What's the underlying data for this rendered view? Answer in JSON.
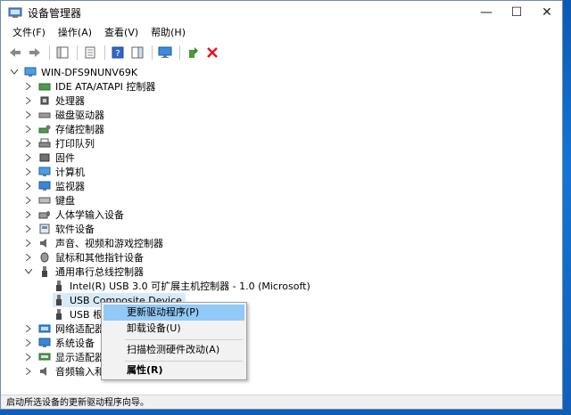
{
  "window": {
    "title": "设备管理器"
  },
  "controls": {
    "minimize": "—",
    "maximize": "☐",
    "close": "✕"
  },
  "menubar": [
    "文件(F)",
    "操作(A)",
    "查看(V)",
    "帮助(H)"
  ],
  "tree": {
    "root": "WIN-DFS9NUNV69K",
    "categories": [
      "IDE ATA/ATAPI 控制器",
      "处理器",
      "磁盘驱动器",
      "存储控制器",
      "打印队列",
      "固件",
      "计算机",
      "监视器",
      "键盘",
      "人体学输入设备",
      "软件设备",
      "声音、视频和游戏控制器",
      "鼠标和其他指针设备",
      "通用串行总线控制器"
    ],
    "usb_children": [
      "Intel(R) USB 3.0 可扩展主机控制器 - 1.0 (Microsoft)",
      "USB Composite Device",
      "USB 根集"
    ],
    "after": [
      "网络适配器",
      "系统设备",
      "显示适配器",
      "音频输入和"
    ]
  },
  "context_menu": {
    "items": [
      "更新驱动程序(P)",
      "卸载设备(U)",
      "扫描检测硬件改动(A)",
      "属性(R)"
    ]
  },
  "status": "启动所选设备的更新驱动程序向导。",
  "colors": {
    "accent": "#0078d7",
    "selection": "#d8eaf9",
    "menu_highlight": "#91c9f7",
    "delete_red": "#e81123"
  }
}
